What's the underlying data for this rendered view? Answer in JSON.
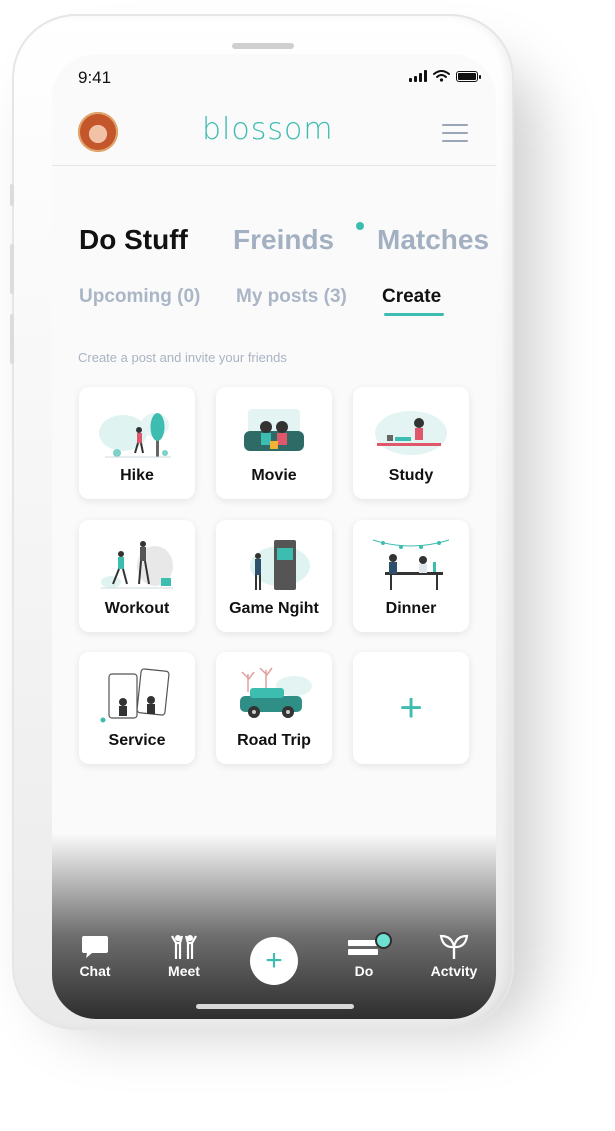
{
  "status": {
    "time": "9:41"
  },
  "app": {
    "logo": "blossom",
    "accent": "#3dbcb0"
  },
  "tabs": [
    {
      "label": "Do Stuff",
      "active": true
    },
    {
      "label": "Freinds",
      "active": false,
      "has_dot": true
    },
    {
      "label": "Matches",
      "active": false
    }
  ],
  "subtabs": [
    {
      "label": "Upcoming (0)",
      "active": false
    },
    {
      "label": "My posts (3)",
      "active": false
    },
    {
      "label": "Create",
      "active": true
    }
  ],
  "hint": "Create a post and invite your friends",
  "cards": [
    {
      "label": "Hike"
    },
    {
      "label": "Movie"
    },
    {
      "label": "Study"
    },
    {
      "label": "Workout"
    },
    {
      "label": "Game Ngiht"
    },
    {
      "label": "Dinner"
    },
    {
      "label": "Service"
    },
    {
      "label": "Road Trip"
    }
  ],
  "add_card": {
    "symbol": "+"
  },
  "nav": [
    {
      "label": "Chat",
      "icon": "chat-bubble-icon"
    },
    {
      "label": "Meet",
      "icon": "people-icon"
    },
    {
      "label": "Do",
      "icon": "list-icon",
      "badge": true
    },
    {
      "label": "Actvity",
      "icon": "sprout-icon"
    }
  ],
  "fab": {
    "symbol": "+"
  }
}
